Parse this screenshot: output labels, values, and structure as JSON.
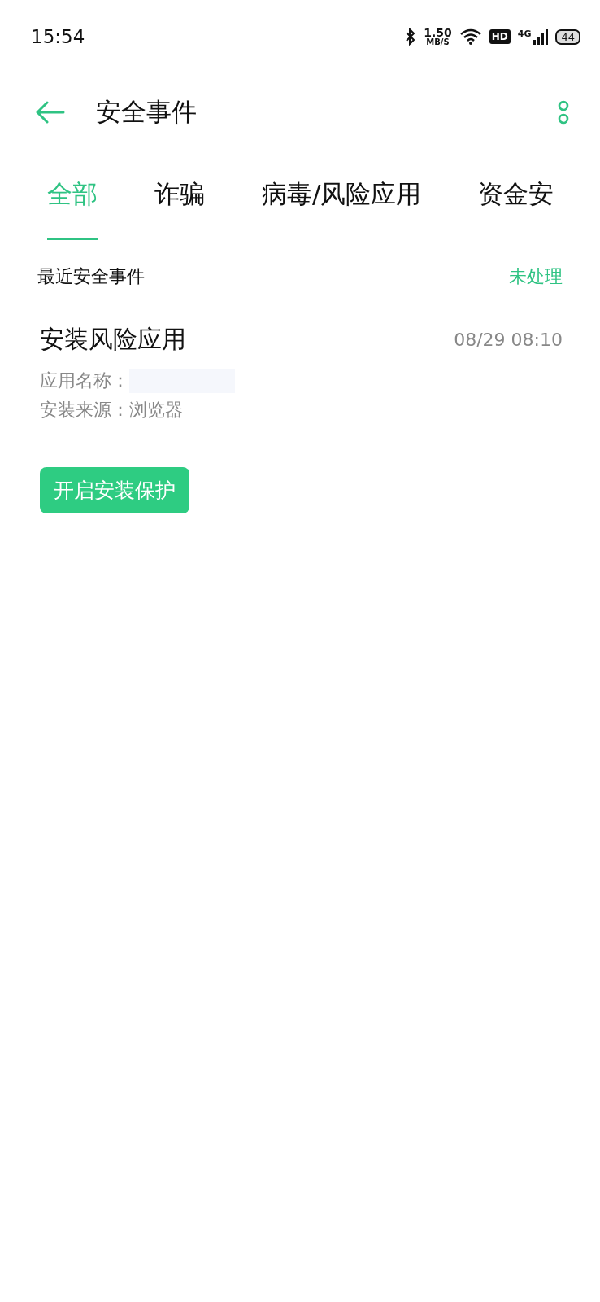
{
  "status_bar": {
    "time": "15:54",
    "speed_value": "1.50",
    "speed_unit": "MB/S",
    "hd_badge": "HD",
    "network": "4G",
    "battery": "44"
  },
  "header": {
    "title": "安全事件"
  },
  "tabs": [
    {
      "label": "全部",
      "selected": true
    },
    {
      "label": "诈骗",
      "selected": false
    },
    {
      "label": "病毒/风险应用",
      "selected": false
    },
    {
      "label": "资金安",
      "selected": false
    }
  ],
  "section": {
    "title": "最近安全事件",
    "filter": "未处理"
  },
  "events": [
    {
      "title": "安装风险应用",
      "time": "08/29 08:10",
      "details": [
        {
          "label": "应用名称：",
          "kind": "redacted"
        },
        {
          "label": "安装来源：",
          "value": "浏览器",
          "kind": "text"
        }
      ],
      "action": "开启安装保护"
    }
  ]
}
